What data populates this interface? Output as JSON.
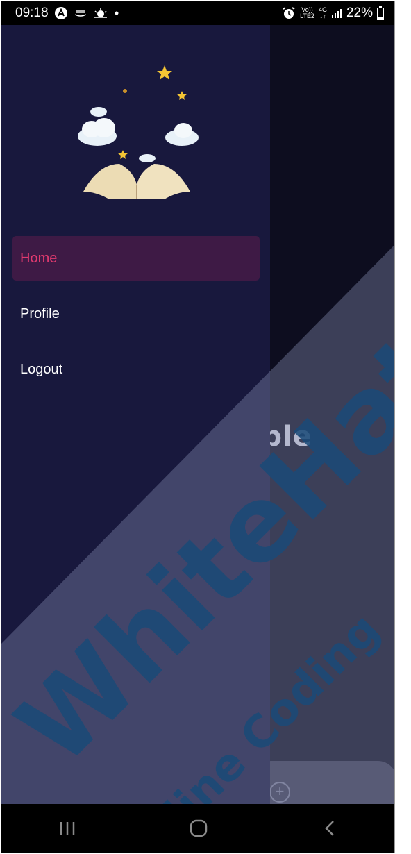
{
  "status_bar": {
    "time": "09:18",
    "volte": "Vo))",
    "lte": "LTE2",
    "network": "4G",
    "battery": "22%"
  },
  "app": {
    "background_text": "ailable"
  },
  "drawer": {
    "menu": [
      {
        "label": "Home",
        "active": true
      },
      {
        "label": "Profile",
        "active": false
      },
      {
        "label": "Logout",
        "active": false
      }
    ]
  },
  "watermark": {
    "main": "WhiteHat",
    "sub": "Online Coding"
  },
  "nav_bar": {
    "recents_icon": "recents-icon",
    "home_icon": "home-icon",
    "back_icon": "back-icon"
  },
  "colors": {
    "drawer_bg": "#18183d",
    "active_item_bg": "#3e1a45",
    "active_item_text": "#e13a6f"
  }
}
